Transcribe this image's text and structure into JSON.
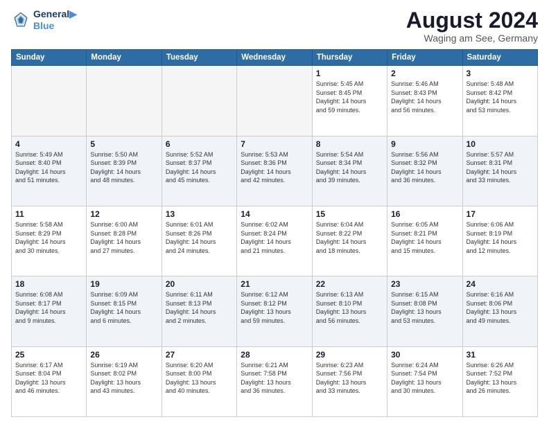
{
  "header": {
    "logo_line1": "General",
    "logo_line2": "Blue",
    "main_title": "August 2024",
    "subtitle": "Waging am See, Germany"
  },
  "calendar": {
    "days_of_week": [
      "Sunday",
      "Monday",
      "Tuesday",
      "Wednesday",
      "Thursday",
      "Friday",
      "Saturday"
    ],
    "weeks": [
      [
        {
          "day": "",
          "info": "",
          "empty": true
        },
        {
          "day": "",
          "info": "",
          "empty": true
        },
        {
          "day": "",
          "info": "",
          "empty": true
        },
        {
          "day": "",
          "info": "",
          "empty": true
        },
        {
          "day": "1",
          "info": "Sunrise: 5:45 AM\nSunset: 8:45 PM\nDaylight: 14 hours\nand 59 minutes.",
          "empty": false
        },
        {
          "day": "2",
          "info": "Sunrise: 5:46 AM\nSunset: 8:43 PM\nDaylight: 14 hours\nand 56 minutes.",
          "empty": false
        },
        {
          "day": "3",
          "info": "Sunrise: 5:48 AM\nSunset: 8:42 PM\nDaylight: 14 hours\nand 53 minutes.",
          "empty": false
        }
      ],
      [
        {
          "day": "4",
          "info": "Sunrise: 5:49 AM\nSunset: 8:40 PM\nDaylight: 14 hours\nand 51 minutes.",
          "empty": false
        },
        {
          "day": "5",
          "info": "Sunrise: 5:50 AM\nSunset: 8:39 PM\nDaylight: 14 hours\nand 48 minutes.",
          "empty": false
        },
        {
          "day": "6",
          "info": "Sunrise: 5:52 AM\nSunset: 8:37 PM\nDaylight: 14 hours\nand 45 minutes.",
          "empty": false
        },
        {
          "day": "7",
          "info": "Sunrise: 5:53 AM\nSunset: 8:36 PM\nDaylight: 14 hours\nand 42 minutes.",
          "empty": false
        },
        {
          "day": "8",
          "info": "Sunrise: 5:54 AM\nSunset: 8:34 PM\nDaylight: 14 hours\nand 39 minutes.",
          "empty": false
        },
        {
          "day": "9",
          "info": "Sunrise: 5:56 AM\nSunset: 8:32 PM\nDaylight: 14 hours\nand 36 minutes.",
          "empty": false
        },
        {
          "day": "10",
          "info": "Sunrise: 5:57 AM\nSunset: 8:31 PM\nDaylight: 14 hours\nand 33 minutes.",
          "empty": false
        }
      ],
      [
        {
          "day": "11",
          "info": "Sunrise: 5:58 AM\nSunset: 8:29 PM\nDaylight: 14 hours\nand 30 minutes.",
          "empty": false
        },
        {
          "day": "12",
          "info": "Sunrise: 6:00 AM\nSunset: 8:28 PM\nDaylight: 14 hours\nand 27 minutes.",
          "empty": false
        },
        {
          "day": "13",
          "info": "Sunrise: 6:01 AM\nSunset: 8:26 PM\nDaylight: 14 hours\nand 24 minutes.",
          "empty": false
        },
        {
          "day": "14",
          "info": "Sunrise: 6:02 AM\nSunset: 8:24 PM\nDaylight: 14 hours\nand 21 minutes.",
          "empty": false
        },
        {
          "day": "15",
          "info": "Sunrise: 6:04 AM\nSunset: 8:22 PM\nDaylight: 14 hours\nand 18 minutes.",
          "empty": false
        },
        {
          "day": "16",
          "info": "Sunrise: 6:05 AM\nSunset: 8:21 PM\nDaylight: 14 hours\nand 15 minutes.",
          "empty": false
        },
        {
          "day": "17",
          "info": "Sunrise: 6:06 AM\nSunset: 8:19 PM\nDaylight: 14 hours\nand 12 minutes.",
          "empty": false
        }
      ],
      [
        {
          "day": "18",
          "info": "Sunrise: 6:08 AM\nSunset: 8:17 PM\nDaylight: 14 hours\nand 9 minutes.",
          "empty": false
        },
        {
          "day": "19",
          "info": "Sunrise: 6:09 AM\nSunset: 8:15 PM\nDaylight: 14 hours\nand 6 minutes.",
          "empty": false
        },
        {
          "day": "20",
          "info": "Sunrise: 6:11 AM\nSunset: 8:13 PM\nDaylight: 14 hours\nand 2 minutes.",
          "empty": false
        },
        {
          "day": "21",
          "info": "Sunrise: 6:12 AM\nSunset: 8:12 PM\nDaylight: 13 hours\nand 59 minutes.",
          "empty": false
        },
        {
          "day": "22",
          "info": "Sunrise: 6:13 AM\nSunset: 8:10 PM\nDaylight: 13 hours\nand 56 minutes.",
          "empty": false
        },
        {
          "day": "23",
          "info": "Sunrise: 6:15 AM\nSunset: 8:08 PM\nDaylight: 13 hours\nand 53 minutes.",
          "empty": false
        },
        {
          "day": "24",
          "info": "Sunrise: 6:16 AM\nSunset: 8:06 PM\nDaylight: 13 hours\nand 49 minutes.",
          "empty": false
        }
      ],
      [
        {
          "day": "25",
          "info": "Sunrise: 6:17 AM\nSunset: 8:04 PM\nDaylight: 13 hours\nand 46 minutes.",
          "empty": false
        },
        {
          "day": "26",
          "info": "Sunrise: 6:19 AM\nSunset: 8:02 PM\nDaylight: 13 hours\nand 43 minutes.",
          "empty": false
        },
        {
          "day": "27",
          "info": "Sunrise: 6:20 AM\nSunset: 8:00 PM\nDaylight: 13 hours\nand 40 minutes.",
          "empty": false
        },
        {
          "day": "28",
          "info": "Sunrise: 6:21 AM\nSunset: 7:58 PM\nDaylight: 13 hours\nand 36 minutes.",
          "empty": false
        },
        {
          "day": "29",
          "info": "Sunrise: 6:23 AM\nSunset: 7:56 PM\nDaylight: 13 hours\nand 33 minutes.",
          "empty": false
        },
        {
          "day": "30",
          "info": "Sunrise: 6:24 AM\nSunset: 7:54 PM\nDaylight: 13 hours\nand 30 minutes.",
          "empty": false
        },
        {
          "day": "31",
          "info": "Sunrise: 6:26 AM\nSunset: 7:52 PM\nDaylight: 13 hours\nand 26 minutes.",
          "empty": false
        }
      ]
    ]
  }
}
